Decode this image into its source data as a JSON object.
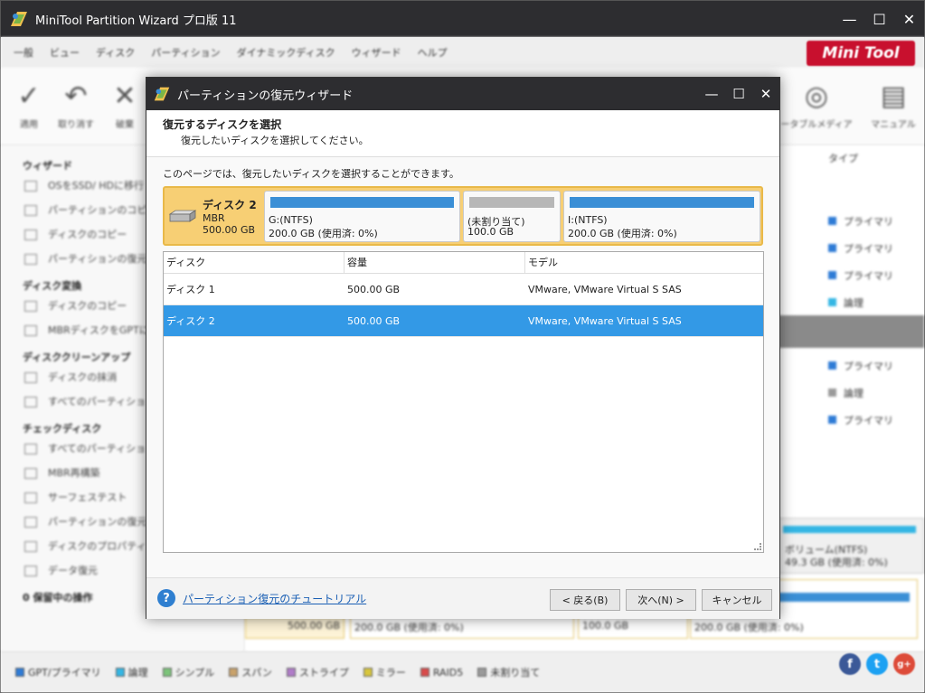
{
  "app": {
    "title": "MiniTool Partition Wizard プロ版 11",
    "brand": "Mini Tool",
    "menu": [
      "一般",
      "ビュー",
      "ディスク",
      "パーティション",
      "ダイナミックディスク",
      "ウィザード",
      "ヘルプ"
    ],
    "toolbar": [
      {
        "label": "適用",
        "icon": "check-icon",
        "glyph": "✓"
      },
      {
        "label": "取り消す",
        "icon": "undo-icon",
        "glyph": "↶"
      },
      {
        "label": "破棄",
        "icon": "discard-icon",
        "glyph": "✕"
      },
      {
        "label": "ータブルメディア",
        "icon": "bootable-media-icon",
        "glyph": "◎"
      },
      {
        "label": "マニュアル",
        "icon": "manual-icon",
        "glyph": "▤"
      }
    ],
    "sidebar": [
      {
        "section": "ウィザード",
        "items": [
          "OSをSSD/ HDに移行",
          "パーティションのコピー",
          "ディスクのコピー",
          "パーティションの復元"
        ]
      },
      {
        "section": "ディスク変換",
        "items": [
          "ディスクのコピー",
          "MBRディスクをGPTに"
        ]
      },
      {
        "section": "ディスククリーンアップ",
        "items": [
          "ディスクの抹消",
          "すべてのパーティション"
        ]
      },
      {
        "section": "チェックディスク",
        "items": [
          "すべてのパーティション",
          "MBR再構築",
          "サーフェステスト",
          "パーティションの復元",
          "ディスクのプロパティ",
          "データ復元"
        ]
      }
    ],
    "pending_ops": "0 保留中の操作",
    "right_header": "タイプ",
    "right_types": [
      "プライマリ",
      "プライマリ",
      "プライマリ",
      "論理",
      "プライマリ",
      "論理",
      "プライマリ"
    ],
    "right_disk_label": "ボリューム(NTFS)",
    "right_disk_size": "49.3 GB (使用済: 0%)",
    "bottom_disk": {
      "size": "500.00 GB",
      "p1": "200.0 GB (使用済: 0%)",
      "p2": "100.0 GB",
      "p3": "200.0 GB (使用済: 0%)"
    },
    "legend": [
      {
        "label": "GPT/プライマリ",
        "color": "#2e7bd6"
      },
      {
        "label": "論理",
        "color": "#34b6e4"
      },
      {
        "label": "シンプル",
        "color": "#7cc47a"
      },
      {
        "label": "スパン",
        "color": "#c9a26b"
      },
      {
        "label": "ストライプ",
        "color": "#b07cc9"
      },
      {
        "label": "ミラー",
        "color": "#d8c63c"
      },
      {
        "label": "RAID5",
        "color": "#d94a4a"
      },
      {
        "label": "未割り当て",
        "color": "#9a9a9a"
      }
    ],
    "social": [
      "f",
      "t",
      "g+"
    ]
  },
  "dialog": {
    "title": "パーティションの復元ウィザード",
    "heading": "復元するディスクを選択",
    "subheading": "復元したいディスクを選択してください。",
    "description": "このページでは、復元したいディスクを選択することができます。",
    "disk_map": {
      "name": "ディスク 2",
      "type": "MBR",
      "size": "500.00 GB",
      "partitions": [
        {
          "label": "G:(NTFS)",
          "detail": "200.0 GB (使用済: 0%)"
        },
        {
          "label": "(未割り当て)",
          "detail": "100.0 GB"
        },
        {
          "label": "I:(NTFS)",
          "detail": "200.0 GB (使用済: 0%)"
        }
      ]
    },
    "table": {
      "headers": [
        "ディスク",
        "容量",
        "モデル"
      ],
      "rows": [
        {
          "disk": "ディスク 1",
          "capacity": "500.00 GB",
          "model": "VMware, VMware Virtual S SAS",
          "selected": false
        },
        {
          "disk": "ディスク 2",
          "capacity": "500.00 GB",
          "model": "VMware, VMware Virtual S SAS",
          "selected": true
        }
      ]
    },
    "tutorial_link": "パーティション復元のチュートリアル",
    "buttons": {
      "back": "< 戻る(B)",
      "next": "次へ(N) >",
      "cancel": "キャンセル"
    }
  }
}
